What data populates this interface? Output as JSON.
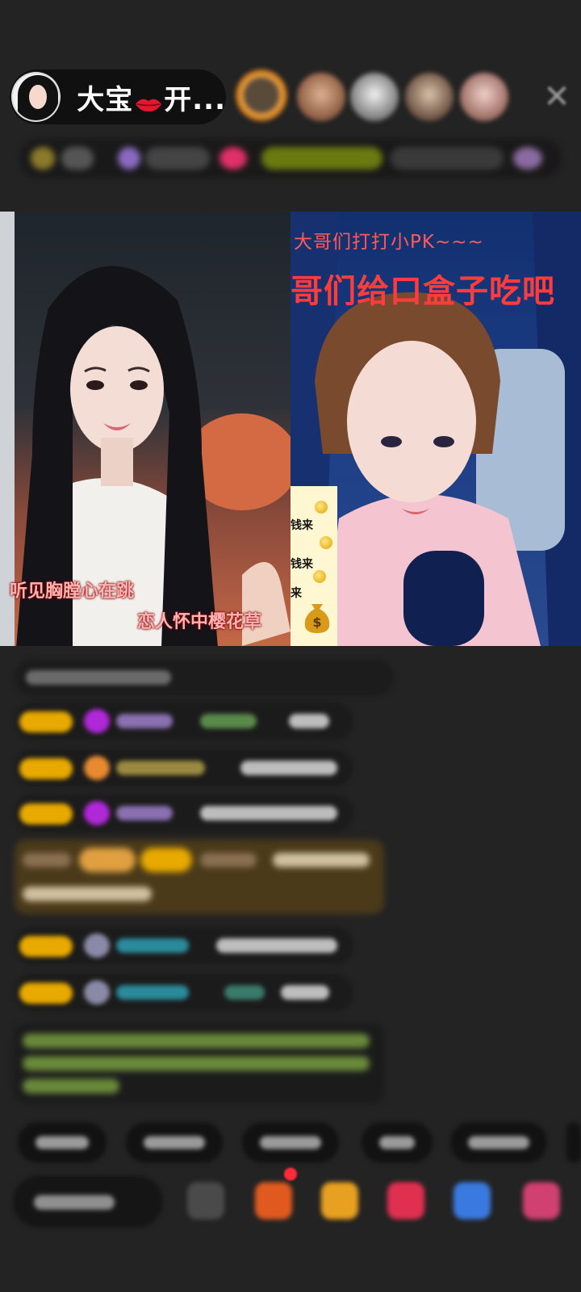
{
  "host": {
    "name": "大宝",
    "suffix": "开..."
  },
  "video": {
    "left_captions": [
      "听见胸膛心在跳",
      "恋人怀中樱花草"
    ],
    "right_top_text": "大哥们打打小PK~~~",
    "right_big_text": "哥们给口盒子吃吧",
    "sticker_lines": [
      "钱来",
      "钱来",
      "来"
    ]
  },
  "colors": {
    "background": "#232323",
    "badge_gold": "#e8a900",
    "right_text_red": "#ff3c3c"
  }
}
